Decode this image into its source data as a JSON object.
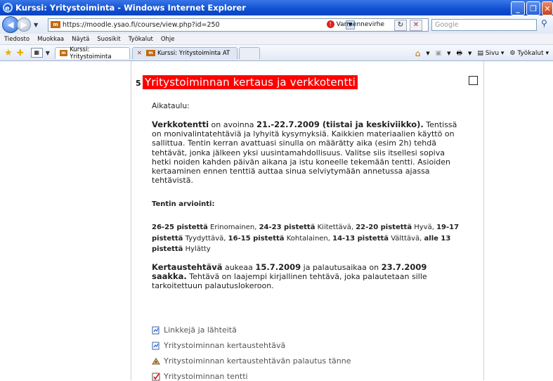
{
  "window": {
    "title": "Kurssi: Yritystoiminta - Windows Internet Explorer"
  },
  "address": {
    "url": "https://moodle.ysao.fi/course/view.php?id=250",
    "cert_error": "Varmennevirhe",
    "search_placeholder": "Google"
  },
  "menu": [
    "Tiedosto",
    "Muokkaa",
    "Näytä",
    "Suosikit",
    "Työkalut",
    "Ohje"
  ],
  "tabs": [
    {
      "label": "Kurssi: Yritystoiminta"
    },
    {
      "label": "Kurssi: Yritystoiminta AT"
    }
  ],
  "command_bar": {
    "page": "Sivu",
    "tools": "Työkalut"
  },
  "section": {
    "number": "5",
    "title": "Yritystoiminnan kertaus ja verkkotentti",
    "schedule_label": "Aikataulu:",
    "exam_intro_bold1": "Verkkotentti",
    "exam_intro_text1": " on avoinna ",
    "exam_intro_bold2": "21.-22.7.2009 (tiistai ja keskiviikko).",
    "exam_intro_text2": " Tentissä on monivalintatehtäviä ja lyhyitä kysymyksiä. Kaikkien materiaalien käyttö on sallittua. Tentin kerran avattuasi sinulla on määrätty aika (esim 2h) tehdä tehtävät, jonka jälkeen yksi uusintamahdollisuus. Valitse siis itsellesi sopiva hetki noiden kahden päivän aikana ja istu koneelle tekemään tentti. Asioiden kertaaminen ennen tenttiä auttaa sinua selviytymään annetussa ajassa tehtävistä.",
    "grading_title": "Tentin arviointi:",
    "g1b": "26-25 pistettä",
    "g1t": " Erinomainen, ",
    "g2b": "24-23 pistettä",
    "g2t": " Kiitettävä, ",
    "g3b": "22-20 pistettä",
    "g3t": " Hyvä, ",
    "g4b": "19-17 pistettä",
    "g4t": " Tyydyttävä, ",
    "g5b": "16-15 pistettä",
    "g5t": " Kohtalainen, ",
    "g6b": "14-13 pistettä",
    "g6t": " Välttävä, ",
    "g7b": "alle 13 pistettä",
    "g7t": " Hylätty",
    "task_bold1": "Kertaustehtävä",
    "task_text1": " aukeaa ",
    "task_bold2": "15.7.2009",
    "task_text2": " ja palautusaikaa on ",
    "task_bold3": "23.7.2009 saakka.",
    "task_text3": " Tehtävä on laajempi kirjallinen tehtävä, joka palautetaan sille tarkoitettuun palautuslokeroon."
  },
  "resources": [
    {
      "label": "Linkkejä ja lähteitä",
      "icon": "page-icon"
    },
    {
      "label": "Yritystoiminnan kertaustehtävä",
      "icon": "page-icon"
    },
    {
      "label": "Yritystoiminnan kertaustehtävän palautus tänne",
      "icon": "assignment-icon"
    },
    {
      "label": "Yritystoiminnan tentti",
      "icon": "quiz-icon"
    }
  ]
}
